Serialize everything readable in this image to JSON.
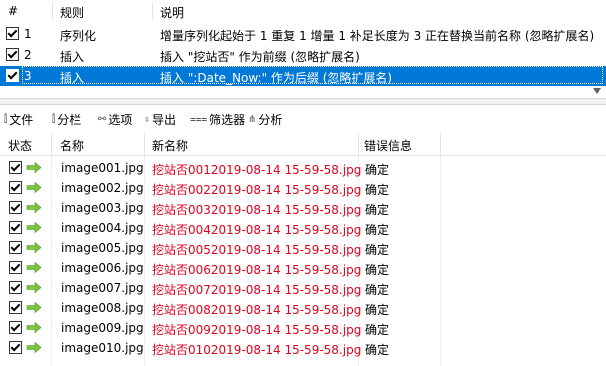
{
  "rules": {
    "headers": {
      "num": "#",
      "rule": "规则",
      "desc": "说明"
    },
    "rows": [
      {
        "num": "1",
        "rule": "序列化",
        "desc": "增量序列化起始于 1 重复 1 增量 1 补足长度为 3 正在替换当前名称 (忽略扩展名)",
        "selected": false
      },
      {
        "num": "2",
        "rule": "插入",
        "desc": "插入 \"挖站否\" 作为前缀 (忽略扩展名)",
        "selected": false
      },
      {
        "num": "3",
        "rule": "插入",
        "desc": "插入 \":Date_Now:\" 作为后缀 (忽略扩展名)",
        "selected": true
      }
    ]
  },
  "toolbar": [
    {
      "icon": "file-icon",
      "glyph": "⫿",
      "label": "文件"
    },
    {
      "icon": "columns-icon",
      "glyph": "⫿",
      "label": "分栏"
    },
    {
      "icon": "options-icon",
      "glyph": "⚯",
      "label": "选项"
    },
    {
      "icon": "export-icon",
      "glyph": "⇳",
      "label": "导出"
    },
    {
      "icon": "filter-icon",
      "glyph": "⩶",
      "label": "筛选器"
    },
    {
      "icon": "analyze-icon",
      "glyph": "⋔",
      "label": "分析"
    }
  ],
  "files": {
    "headers": {
      "state": "状态",
      "name": "名称",
      "newname": "新名称",
      "error": "错误信息"
    },
    "rows": [
      {
        "name": "image001.jpg",
        "newname": "挖站否0012019-08-14 15-59-58.jpg",
        "status": "确定"
      },
      {
        "name": "image002.jpg",
        "newname": "挖站否0022019-08-14 15-59-58.jpg",
        "status": "确定"
      },
      {
        "name": "image003.jpg",
        "newname": "挖站否0032019-08-14 15-59-58.jpg",
        "status": "确定"
      },
      {
        "name": "image004.jpg",
        "newname": "挖站否0042019-08-14 15-59-58.jpg",
        "status": "确定"
      },
      {
        "name": "image005.jpg",
        "newname": "挖站否0052019-08-14 15-59-58.jpg",
        "status": "确定"
      },
      {
        "name": "image006.jpg",
        "newname": "挖站否0062019-08-14 15-59-58.jpg",
        "status": "确定"
      },
      {
        "name": "image007.jpg",
        "newname": "挖站否0072019-08-14 15-59-58.jpg",
        "status": "确定"
      },
      {
        "name": "image008.jpg",
        "newname": "挖站否0082019-08-14 15-59-58.jpg",
        "status": "确定"
      },
      {
        "name": "image009.jpg",
        "newname": "挖站否0092019-08-14 15-59-58.jpg",
        "status": "确定"
      },
      {
        "name": "image010.jpg",
        "newname": "挖站否0102019-08-14 15-59-58.jpg",
        "status": "确定"
      }
    ]
  },
  "colors": {
    "selection": "#0078d7",
    "new_name": "#e0001b",
    "arrow": "#7cc242"
  }
}
